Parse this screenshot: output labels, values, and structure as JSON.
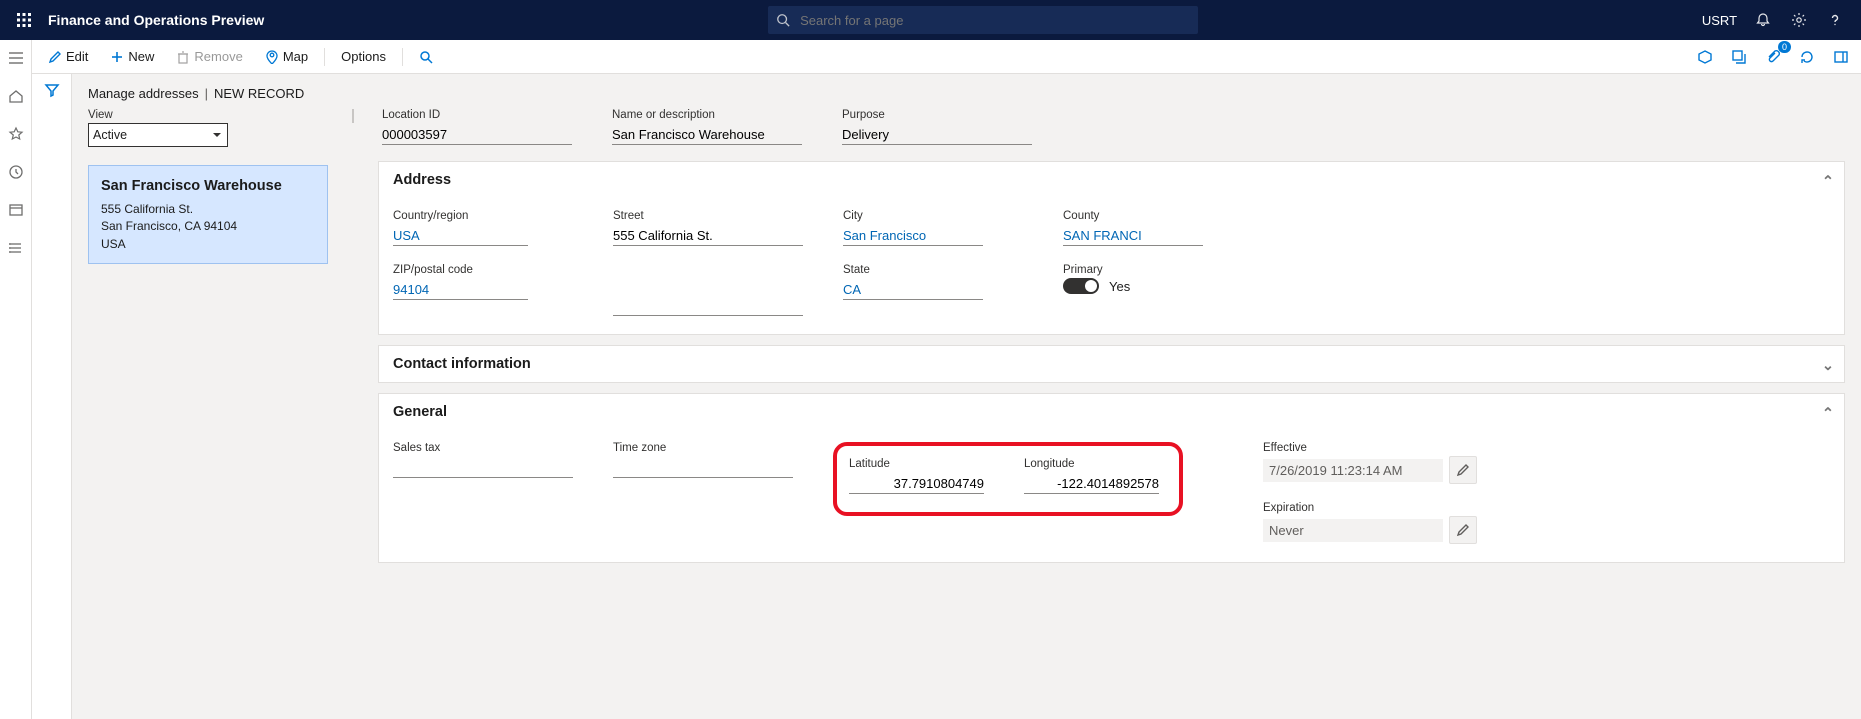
{
  "header": {
    "title": "Finance and Operations Preview",
    "search_placeholder": "Search for a page",
    "user": "USRT"
  },
  "actionbar": {
    "edit": "Edit",
    "new": "New",
    "remove": "Remove",
    "map": "Map",
    "options": "Options",
    "attach_count": "0"
  },
  "breadcrumb": {
    "a": "Manage addresses",
    "sep": "|",
    "b": "NEW RECORD"
  },
  "list": {
    "view_label": "View",
    "view_value": "Active",
    "card": {
      "name": "San Francisco Warehouse",
      "l1": "555 California St.",
      "l2": "San Francisco, CA 94104",
      "l3": "USA"
    }
  },
  "record": {
    "location_label": "Location ID",
    "location": "000003597",
    "name_label": "Name or description",
    "name": "San Francisco Warehouse",
    "purpose_label": "Purpose",
    "purpose": "Delivery"
  },
  "sections": {
    "address": "Address",
    "contact": "Contact information",
    "general": "General"
  },
  "address": {
    "country_label": "Country/region",
    "country": "USA",
    "zip_label": "ZIP/postal code",
    "zip": "94104",
    "street_label": "Street",
    "street": "555 California St.",
    "city_label": "City",
    "city": "San Francisco",
    "state_label": "State",
    "state": "CA",
    "county_label": "County",
    "county": "SAN FRANCI",
    "primary_label": "Primary",
    "primary_text": "Yes"
  },
  "general": {
    "salestax_label": "Sales tax",
    "timezone_label": "Time zone",
    "lat_label": "Latitude",
    "lat": "37.7910804749",
    "lon_label": "Longitude",
    "lon": "-122.4014892578",
    "effective_label": "Effective",
    "effective": "7/26/2019 11:23:14 AM",
    "expiration_label": "Expiration",
    "expiration": "Never"
  }
}
